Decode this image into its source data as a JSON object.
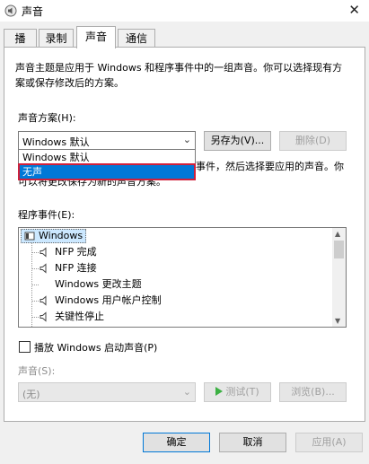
{
  "window": {
    "title": "声音",
    "close_glyph": "✕"
  },
  "tabs": [
    {
      "label": "播放"
    },
    {
      "label": "录制"
    },
    {
      "label": "声音"
    },
    {
      "label": "通信"
    }
  ],
  "sounds_tab": {
    "description": "声音主题是应用于 Windows 和程序事件中的一组声音。你可以选择现有方案或保存修改后的方案。",
    "scheme_label": "声音方案(H):",
    "scheme_value": "Windows 默认",
    "save_as_label": "另存为(V)...",
    "delete_label": "删除(D)",
    "dropdown_options": [
      "Windows 默认",
      "无声"
    ],
    "dropdown_selected_index": 1,
    "obscured_text": "若要更改声音，请单击以下列表中的程序事件，然后选择要应用的声音。你可以将更改保存为新的声音方案。",
    "events_label": "程序事件(E):",
    "events": [
      {
        "label": "Windows",
        "level": 0,
        "has_sound": false
      },
      {
        "label": "NFP 完成",
        "level": 1,
        "has_sound": true
      },
      {
        "label": "NFP 连接",
        "level": 1,
        "has_sound": true
      },
      {
        "label": "Windows 更改主题",
        "level": 1,
        "has_sound": false
      },
      {
        "label": "Windows 用户帐户控制",
        "level": 1,
        "has_sound": true
      },
      {
        "label": "关键性停止",
        "level": 1,
        "has_sound": true
      }
    ],
    "play_startup_label": "播放 Windows 启动声音(P)",
    "play_startup_checked": false,
    "sound_label": "声音(S):",
    "sound_value": "(无)",
    "test_label": "测试(T)",
    "browse_label": "浏览(B)..."
  },
  "footer": {
    "ok_label": "确定",
    "cancel_label": "取消",
    "apply_label": "应用(A)"
  },
  "colors": {
    "selection": "#0078d7",
    "highlight_outline": "#d0203a",
    "play_icon": "#3cb043"
  }
}
